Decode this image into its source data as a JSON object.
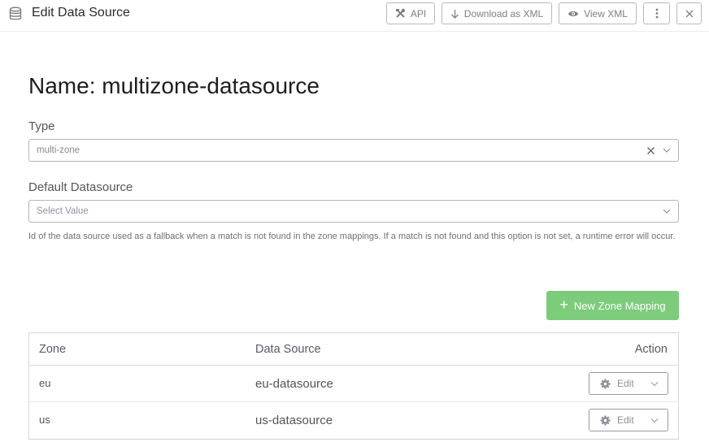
{
  "header": {
    "title": "Edit Data Source",
    "icon": "database-icon",
    "buttons": {
      "api": "API",
      "download": "Download as XML",
      "view": "View XML"
    }
  },
  "page": {
    "title": "Name: multizone-datasource"
  },
  "form": {
    "type": {
      "label": "Type",
      "value": "multi-zone"
    },
    "default_datasource": {
      "label": "Default Datasource",
      "placeholder": "Select Value",
      "help": "Id of the data source used as a fallback when a match is not found in the zone mappings. If a match is not found and this option is not set, a runtime error will occur."
    }
  },
  "new_mapping_button": "New Zone Mapping",
  "colors": {
    "accent_green": "#7ccc7c"
  },
  "table": {
    "columns": [
      "Zone",
      "Data Source",
      "Action"
    ],
    "rows": [
      {
        "zone": "eu",
        "data_source": "eu-datasource",
        "action": "Edit"
      },
      {
        "zone": "us",
        "data_source": "us-datasource",
        "action": "Edit"
      }
    ]
  }
}
